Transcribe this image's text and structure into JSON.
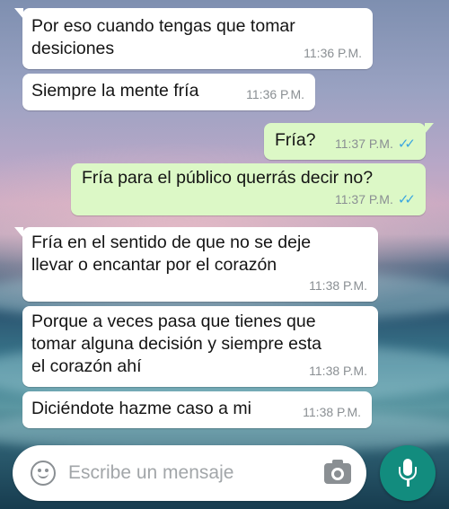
{
  "messages": [
    {
      "direction": "incoming",
      "text_lines": [
        "Por eso cuando tengas que tomar",
        "desiciones"
      ],
      "time": "11:36 P.M."
    },
    {
      "direction": "incoming",
      "text_lines": [
        "Siempre la mente fría"
      ],
      "time": "11:36 P.M."
    },
    {
      "direction": "outgoing",
      "text_lines": [
        "Fría?"
      ],
      "time": "11:37 P.M.",
      "status": "read"
    },
    {
      "direction": "outgoing",
      "text_lines": [
        "Fría para el público querrás decir no?"
      ],
      "time": "11:37 P.M.",
      "status": "read"
    },
    {
      "direction": "incoming",
      "text_lines": [
        "Fría en el sentido de que no se deje",
        "llevar o encantar por el corazón"
      ],
      "time": "11:38 P.M."
    },
    {
      "direction": "incoming",
      "text_lines": [
        "Porque a veces pasa que tienes que",
        "tomar alguna decisión y siempre esta",
        "el corazón ahí"
      ],
      "time": "11:38 P.M."
    },
    {
      "direction": "incoming",
      "text_lines": [
        "Diciéndote hazme caso a mi"
      ],
      "time": "11:38 P.M."
    }
  ],
  "input": {
    "placeholder": "Escribe un mensaje",
    "value": "",
    "emoji_icon": "emoji-icon",
    "camera_icon": "camera-icon"
  },
  "mic_button": {
    "icon": "microphone-icon",
    "color": "#128c7e"
  },
  "colors": {
    "incoming_bubble": "#ffffff",
    "outgoing_bubble": "#dcf8c6",
    "read_ticks": "#3aa6e0",
    "timestamp": "#8a8f93"
  }
}
